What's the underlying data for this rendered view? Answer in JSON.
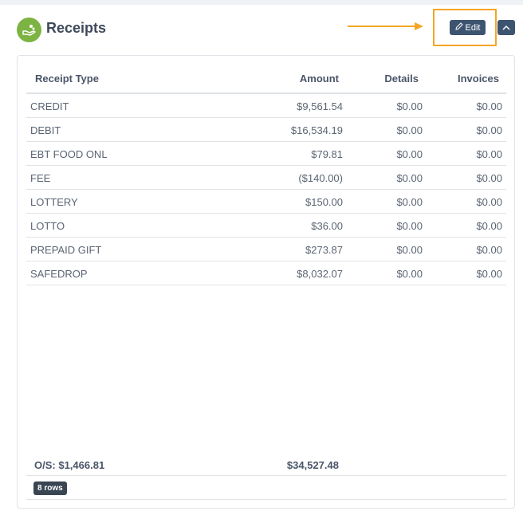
{
  "header": {
    "title": "Receipts",
    "icon": "money-hand-icon",
    "edit_label": "Edit",
    "edit_icon": "pencil-icon",
    "collapse_icon": "chevron-up-icon"
  },
  "table": {
    "columns": {
      "type": "Receipt Type",
      "amount": "Amount",
      "details": "Details",
      "invoices": "Invoices"
    },
    "rows": [
      {
        "type": "CREDIT",
        "amount": "$9,561.54",
        "details": "$0.00",
        "invoices": "$0.00"
      },
      {
        "type": "DEBIT",
        "amount": "$16,534.19",
        "details": "$0.00",
        "invoices": "$0.00"
      },
      {
        "type": "EBT FOOD ONL",
        "amount": "$79.81",
        "details": "$0.00",
        "invoices": "$0.00"
      },
      {
        "type": "FEE",
        "amount": "($140.00)",
        "details": "$0.00",
        "invoices": "$0.00"
      },
      {
        "type": "LOTTERY",
        "amount": "$150.00",
        "details": "$0.00",
        "invoices": "$0.00"
      },
      {
        "type": "LOTTO",
        "amount": "$36.00",
        "details": "$0.00",
        "invoices": "$0.00"
      },
      {
        "type": "PREPAID GIFT",
        "amount": "$273.87",
        "details": "$0.00",
        "invoices": "$0.00"
      },
      {
        "type": "SAFEDROP",
        "amount": "$8,032.07",
        "details": "$0.00",
        "invoices": "$0.00"
      }
    ],
    "footer": {
      "os_label": "O/S: $1,466.81",
      "total_amount": "$34,527.48"
    },
    "row_count": "8 rows"
  },
  "colors": {
    "accent": "#3d5470",
    "icon_green": "#7cb342",
    "highlight": "#f5a524"
  }
}
